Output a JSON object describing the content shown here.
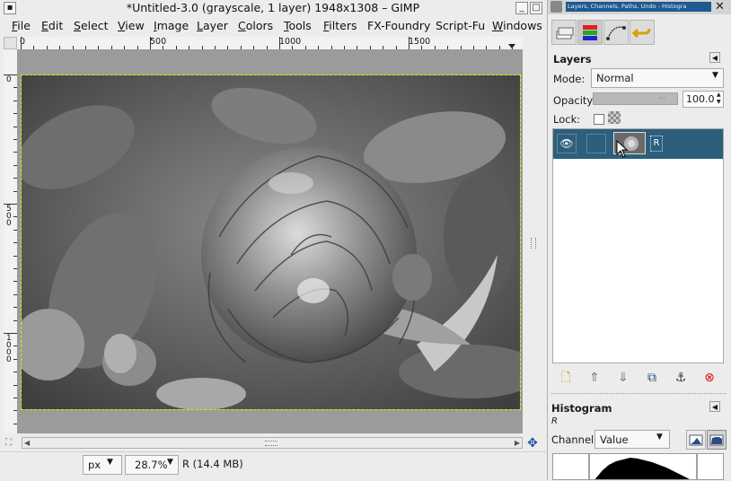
{
  "window": {
    "title": "*Untitled-3.0 (grayscale, 1 layer) 1948x1308 – GIMP"
  },
  "menu": [
    {
      "label": "File",
      "u": "F",
      "rest": "ile"
    },
    {
      "label": "Edit",
      "u": "E",
      "rest": "dit"
    },
    {
      "label": "Select",
      "u": "S",
      "rest": "elect"
    },
    {
      "label": "View",
      "u": "V",
      "rest": "iew"
    },
    {
      "label": "Image",
      "u": "I",
      "rest": "mage"
    },
    {
      "label": "Layer",
      "u": "L",
      "rest": "ayer"
    },
    {
      "label": "Colors",
      "u": "C",
      "rest": "olors"
    },
    {
      "label": "Tools",
      "u": "T",
      "rest": "ools"
    },
    {
      "label": "Filters",
      "u": "F",
      "rest": "ilters"
    },
    {
      "label": "FX-Foundry",
      "u": "",
      "rest": "FX-Foundry"
    },
    {
      "label": "Script-Fu",
      "u": "",
      "rest": "Script-Fu"
    },
    {
      "label": "Windows",
      "u": "W",
      "rest": "indows"
    }
  ],
  "rulers": {
    "horizontal": [
      "0",
      "500",
      "1000",
      "1500"
    ],
    "vertical": [
      "0",
      "500",
      "1000"
    ]
  },
  "status": {
    "unit": "px",
    "zoom": "28.7%",
    "info": "R (14.4 MB)"
  },
  "dock": {
    "title": "Layers, Channels, Paths, Undo - Histogra",
    "layers": {
      "title": "Layers",
      "mode_label": "Mode:",
      "mode_value": "Normal",
      "opacity_label": "Opacity:",
      "opacity_value": "100.0",
      "lock_label": "Lock:",
      "layer_name": "R"
    },
    "histogram": {
      "title": "Histogram",
      "channel_name": "R",
      "channel_label": "Channel:",
      "channel_value": "Value"
    }
  },
  "colors": {
    "selection": "#2d5f7c",
    "dock_title": "#1d5a8f",
    "canvas_bg": "#9b9b9b",
    "layer_boundary": "#e8e800"
  }
}
